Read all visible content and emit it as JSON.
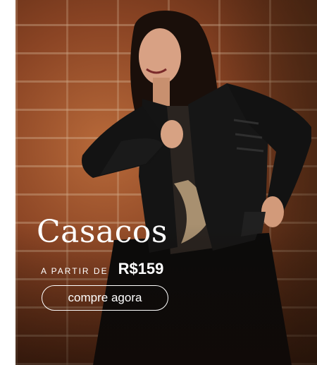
{
  "banner": {
    "title": "Casacos",
    "price_prefix": "A PARTIR DE",
    "price_value": "R$159",
    "cta_label": "compre agora"
  },
  "colors": {
    "text": "#ffffff",
    "brick": "#8a4424",
    "jacket": "#141414"
  },
  "image": {
    "description_icon": "model-in-leather-jacket-photo"
  }
}
